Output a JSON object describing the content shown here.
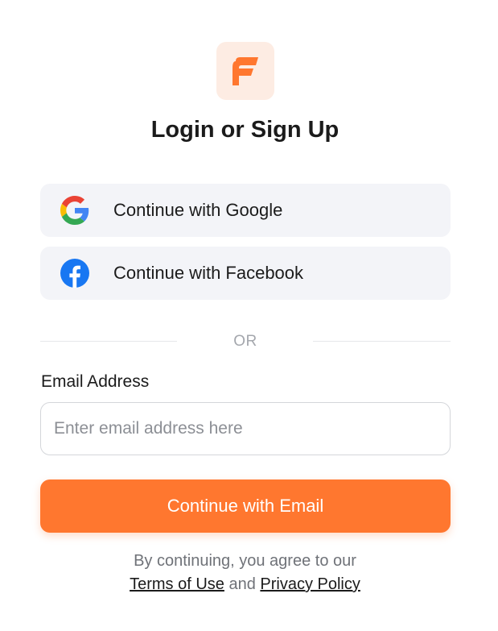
{
  "brand": {
    "logo_icon": "brand-f-logo-icon",
    "accent_color": "#ff772f",
    "logo_bg_color": "#fdece3"
  },
  "header": {
    "title": "Login or Sign Up"
  },
  "social": {
    "google": {
      "label": "Continue with Google",
      "icon": "google-icon"
    },
    "facebook": {
      "label": "Continue with Facebook",
      "icon": "facebook-icon",
      "color": "#1877f2"
    }
  },
  "divider": {
    "text": "OR"
  },
  "email": {
    "label": "Email Address",
    "placeholder": "Enter email address here",
    "value": "",
    "button_label": "Continue with Email"
  },
  "legal": {
    "prefix": "By continuing, you agree to our",
    "terms_label": "Terms of Use",
    "conjunction": "and",
    "privacy_label": "Privacy Policy"
  }
}
